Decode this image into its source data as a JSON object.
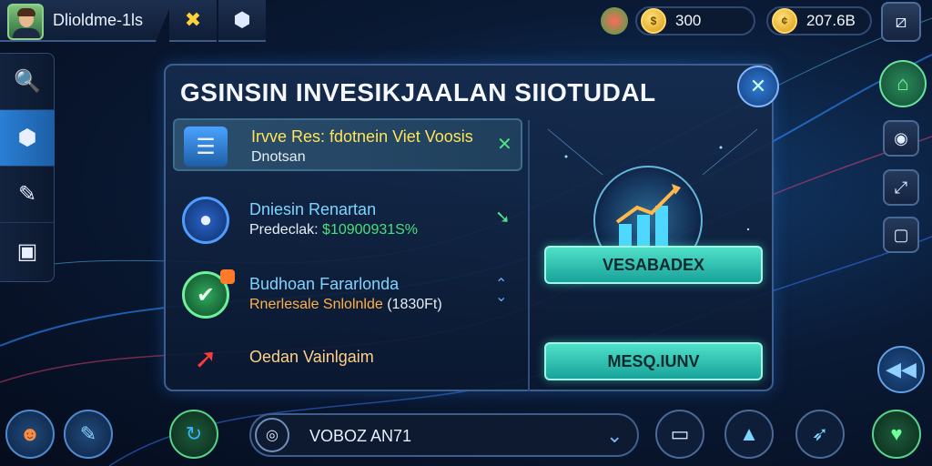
{
  "top": {
    "player_name": "Dlioldme-1ls",
    "currency1": "300",
    "currency2": "207.6B"
  },
  "panel": {
    "title": "GSINSIN INVESIKJAALAN SIIOTUDAL",
    "items": [
      {
        "title": "Irvve Res: fdotnein Viet Voosis",
        "subtitle": "Dnotsan"
      },
      {
        "title": "Dniesin Renartan",
        "subtitle_label": "Predeclak:",
        "subtitle_value": "$10900931S%"
      },
      {
        "title": "Budhoan Fararlonda",
        "subtitle_label": "Rnerlesale Snlolnlde",
        "subtitle_value": "(1830Ft)"
      },
      {
        "title": "Oedan Vainlgaim"
      }
    ],
    "button_primary": "VESABADEX",
    "button_secondary": "MESQ.IUNV"
  },
  "bottom": {
    "dropdown_value": "VOBOZ AN71"
  },
  "colors": {
    "accent_blue": "#2a7fd4",
    "accent_teal": "#3ccfb8",
    "highlight_yellow": "#ffe45a",
    "value_green": "#48e07a",
    "value_orange": "#ffb04a"
  },
  "icons": {
    "top": [
      "avatar",
      "tools-icon",
      "shield-icon",
      "gift-icon",
      "coin-icon",
      "gold-coin-icon",
      "exit-icon"
    ],
    "left": [
      "search-icon",
      "box-icon",
      "edit-icon",
      "chest-icon"
    ],
    "right": [
      "home-icon",
      "camera-icon",
      "chart-icon",
      "wallet-icon",
      "rewind-icon"
    ],
    "bottom": [
      "character-icon",
      "ticket-icon",
      "refresh-icon",
      "target-icon",
      "device-icon",
      "building-icon",
      "boost-icon",
      "heart-icon"
    ]
  }
}
